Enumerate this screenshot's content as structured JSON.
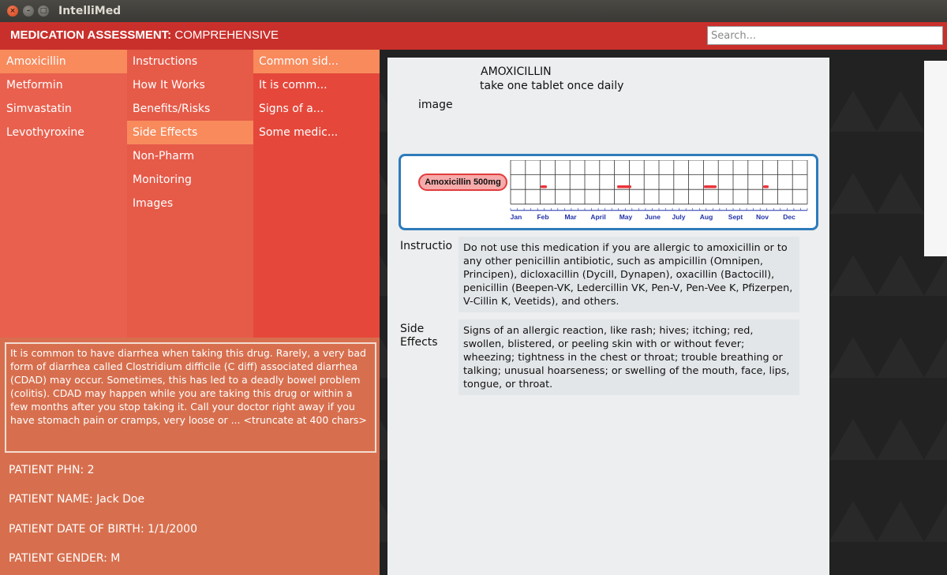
{
  "window": {
    "title": "IntelliMed",
    "controls": {
      "close": "×",
      "minimize": "–",
      "maximize": "□"
    }
  },
  "header": {
    "title_bold": "MEDICATION ASSESSMENT:",
    "title_rest": " COMPREHENSIVE",
    "search_placeholder": "Search..."
  },
  "medications": {
    "items": [
      {
        "label": "Amoxicillin",
        "selected": true
      },
      {
        "label": "Metformin",
        "selected": false
      },
      {
        "label": "Simvastatin",
        "selected": false
      },
      {
        "label": "Levothyroxine",
        "selected": false
      }
    ]
  },
  "categories": {
    "items": [
      {
        "label": "Instructions",
        "selected": false
      },
      {
        "label": "How It Works",
        "selected": false
      },
      {
        "label": "Benefits/Risks",
        "selected": false
      },
      {
        "label": "Side Effects",
        "selected": true
      },
      {
        "label": "Non-Pharm",
        "selected": false
      },
      {
        "label": "Monitoring",
        "selected": false
      },
      {
        "label": "Images",
        "selected": false
      }
    ]
  },
  "details": {
    "items": [
      {
        "label": "Common sid...",
        "selected": true
      },
      {
        "label": "It is comm...",
        "selected": false
      },
      {
        "label": "Signs of a...",
        "selected": false
      },
      {
        "label": "Some medic...",
        "selected": false
      }
    ]
  },
  "description": "It is common to have diarrhea when taking this drug. Rarely, a very bad form of diarrhea called Clostridium difficile (C diff) associated diarrhea (CDAD) may occur. Sometimes, this has led to a deadly bowel problem (colitis). CDAD may happen while you are taking this drug or within a few months after you stop taking it. Call your doctor right away if you have stomach pain or cramps, very loose or ... <truncate at 400 chars>",
  "patient": {
    "phn": "PATIENT PHN: 2",
    "name": "PATIENT NAME: Jack Doe",
    "dob": "PATIENT DATE OF BIRTH: 1/1/2000",
    "gender": "PATIENT GENDER: M"
  },
  "document": {
    "drug_name": "AMOXICILLIN",
    "dose": "take one tablet once daily",
    "image_label": "image",
    "timeline": {
      "pill_label": "Amoxicillin 500mg",
      "months": [
        "Jan",
        "Feb",
        "Mar",
        "April",
        "May",
        "June",
        "July",
        "Aug",
        "Sept",
        "Nov",
        "Dec"
      ],
      "marker_color": "#e8343a"
    },
    "rows": [
      {
        "label": "Instructio",
        "text": "Do not use this medication if you are allergic to amoxicillin or to any other penicillin antibiotic, such as ampicillin (Omnipen, Principen), dicloxacillin (Dycill, Dynapen), oxacillin (Bactocill), penicillin (Beepen-VK, Ledercillin VK, Pen-V, Pen-Vee K, Pfizerpen, V-Cillin K, Veetids), and others."
      },
      {
        "label": "Side Effects",
        "text": "Signs of an allergic reaction, like rash; hives; itching; red, swollen,  blistered, or peeling skin with or without fever; wheezing; tightness in the chest or throat; trouble breathing or talking; unusual hoarseness; or swelling of the mouth, face, lips, tongue, or throat."
      }
    ]
  },
  "colors": {
    "header": "#c9302c",
    "selected": "#f88a5c",
    "timeline_border": "#2e7bbb"
  }
}
